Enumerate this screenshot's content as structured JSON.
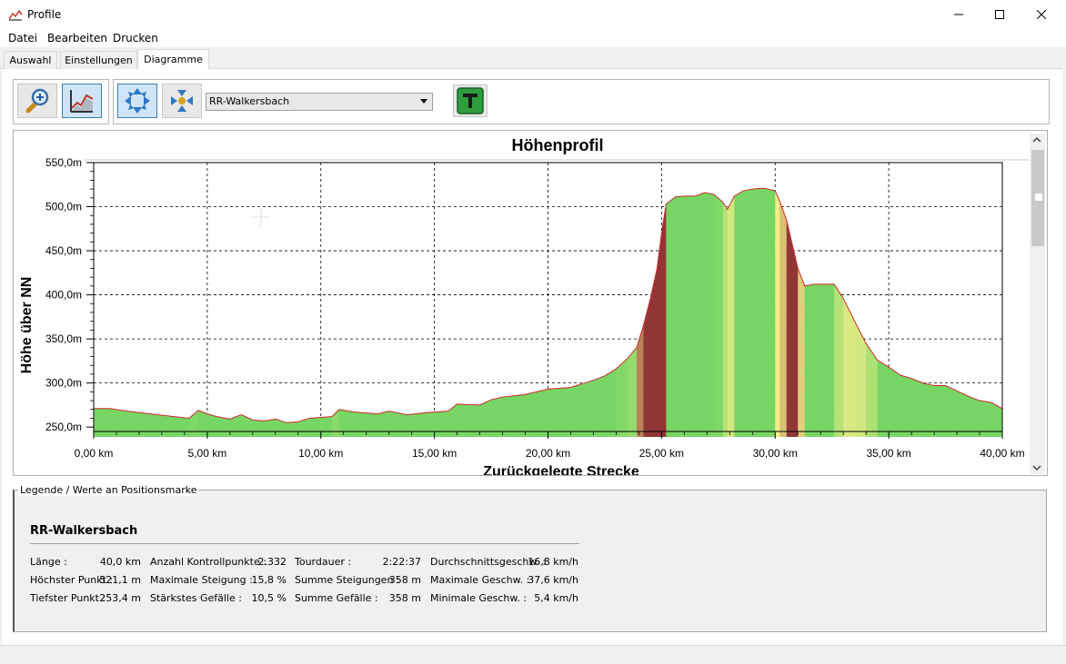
{
  "window": {
    "title": "Profile"
  },
  "menu": [
    "Datei",
    "Bearbeiten",
    "Drucken"
  ],
  "tabs": [
    "Auswahl",
    "Einstellungen",
    "Diagramme"
  ],
  "toolbar": {
    "buttons": [
      "zoom-icon",
      "chart-view-icon",
      "expand-icon",
      "collapse-icon",
      "text-icon"
    ],
    "route_select_value": "RR-Walkersbach"
  },
  "chart_data": {
    "type": "area",
    "title": "Höhenprofil",
    "xlabel": "Zurückgelegte Strecke",
    "ylabel": "Höhe über NN",
    "xlim": [
      0,
      40
    ],
    "ylim": [
      245,
      550
    ],
    "grid": true,
    "xticks": [
      "0,00 km",
      "5,00 km",
      "10,00 km",
      "15,00 km",
      "20,00 km",
      "25,00 km",
      "30,00 km",
      "35,00 km",
      "40,00 km"
    ],
    "yticks": [
      "250,0m",
      "300,0m",
      "350,0m",
      "400,0m",
      "450,0m",
      "500,0m",
      "550,0m"
    ],
    "x": [
      0,
      0.7,
      1.5,
      2.5,
      3.5,
      4.2,
      4.6,
      5.0,
      5.4,
      6.0,
      6.5,
      7.0,
      7.5,
      8.0,
      8.5,
      9.0,
      9.5,
      10.0,
      10.5,
      10.8,
      11.5,
      12.5,
      13.0,
      13.8,
      14.5,
      15.0,
      15.6,
      16.0,
      17.0,
      17.5,
      18.0,
      19.0,
      20.0,
      21.0,
      22.0,
      22.5,
      23.0,
      23.5,
      23.9,
      24.2,
      24.5,
      24.8,
      25.0,
      25.2,
      25.6,
      26.0,
      26.5,
      26.9,
      27.3,
      27.7,
      27.9,
      28.2,
      28.6,
      29.0,
      29.5,
      30.0,
      30.2,
      30.5,
      31.0,
      31.3,
      31.7,
      32.2,
      32.6,
      33.0,
      33.5,
      34.0,
      34.5,
      35.0,
      35.5,
      36.0,
      36.5,
      37.0,
      37.5,
      38.0,
      38.5,
      39.0,
      39.5,
      40.0
    ],
    "y": [
      271,
      271,
      268,
      265,
      262,
      260,
      269,
      265,
      262,
      259,
      264,
      258,
      257,
      259,
      255,
      256,
      260,
      261,
      262,
      270,
      267,
      265,
      268,
      264,
      266,
      267,
      268,
      276,
      275,
      281,
      284,
      287,
      293,
      295,
      303,
      308,
      316,
      328,
      340,
      365,
      395,
      430,
      470,
      503,
      511,
      512,
      512,
      516,
      514,
      505,
      497,
      512,
      518,
      520,
      521,
      518,
      506,
      485,
      430,
      410,
      412,
      412,
      412,
      396,
      370,
      345,
      326,
      318,
      309,
      305,
      300,
      297,
      297,
      291,
      285,
      280,
      278,
      271
    ],
    "stripe_colors": {
      "flat": "#6fd35b",
      "moderate": "#f0ed82",
      "steep": "#8b2a2a",
      "outline": "#cc2a2a"
    }
  },
  "legend": {
    "title": "Legende / Werte an Positionsmarke",
    "route_name": "RR-Walkersbach",
    "stats": [
      [
        "Länge :",
        "40,0 km",
        "Anzahl Kontrollpunkte :",
        "2.332",
        "Tourdauer :",
        "2:22:37",
        "Durchschnittsgeschw. :",
        "16,8 km/h"
      ],
      [
        "Höchster Punkt :",
        "521,1 m",
        "Maximale Steigung :",
        "15,8 %",
        "Summe Steigungen :",
        "358 m",
        "Maximale Geschw. :",
        "37,6 km/h"
      ],
      [
        "Tiefster Punkt :",
        "253,4 m",
        "Stärkstes Gefälle :",
        "10,5 %",
        "Summe Gefälle :",
        "358 m",
        "Minimale Geschw. :",
        "5,4 km/h"
      ]
    ]
  }
}
